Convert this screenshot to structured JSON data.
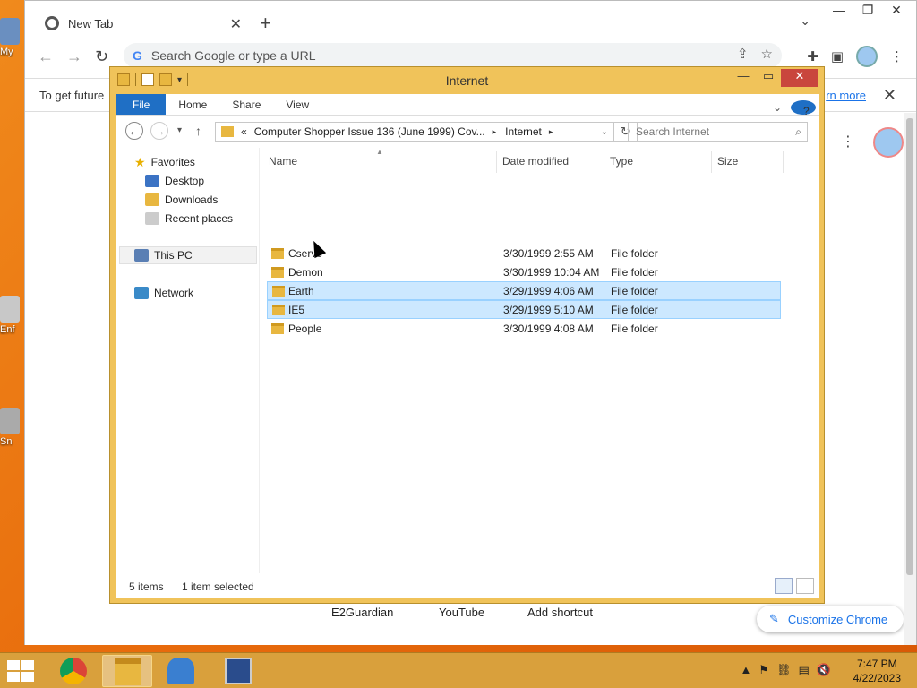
{
  "desktop": {
    "icons": [
      {
        "label": "My"
      },
      {
        "label": "Enf"
      },
      {
        "label": "Sn"
      }
    ]
  },
  "chrome": {
    "tab_title": "New Tab",
    "omnibox_placeholder": "Search Google or type a URL",
    "info_text": "To get future",
    "info_link": "rn more",
    "shortcuts": [
      "E2Guardian",
      "YouTube",
      "Add shortcut"
    ],
    "customize_label": "Customize Chrome"
  },
  "explorer": {
    "title": "Internet",
    "ribbon_tabs": [
      "File",
      "Home",
      "Share",
      "View"
    ],
    "address": {
      "prefix": "«",
      "crumbs": [
        "Computer Shopper Issue 136 (June 1999) Cov...",
        "Internet"
      ]
    },
    "search_placeholder": "Search Internet",
    "nav": {
      "favorites": "Favorites",
      "favorite_items": [
        "Desktop",
        "Downloads",
        "Recent places"
      ],
      "this_pc": "This PC",
      "network": "Network"
    },
    "columns": [
      "Name",
      "Date modified",
      "Type",
      "Size"
    ],
    "files": [
      {
        "name": "Cserve",
        "date": "3/30/1999 2:55 AM",
        "type": "File folder",
        "selected": false
      },
      {
        "name": "Demon",
        "date": "3/30/1999 10:04 AM",
        "type": "File folder",
        "selected": false
      },
      {
        "name": "Earth",
        "date": "3/29/1999 4:06 AM",
        "type": "File folder",
        "selected": true
      },
      {
        "name": "IE5",
        "date": "3/29/1999 5:10 AM",
        "type": "File folder",
        "selected": true
      },
      {
        "name": "People",
        "date": "3/30/1999 4:08 AM",
        "type": "File folder",
        "selected": false
      }
    ],
    "status": {
      "items": "5 items",
      "selected": "1 item selected"
    }
  },
  "taskbar": {
    "time": "7:47 PM",
    "date": "4/22/2023"
  },
  "colors": {
    "explorer_frame": "#f0c35a",
    "selection": "#cce8ff",
    "ribbon_file": "#1f6fc5",
    "taskbar": "#d9a03c"
  }
}
